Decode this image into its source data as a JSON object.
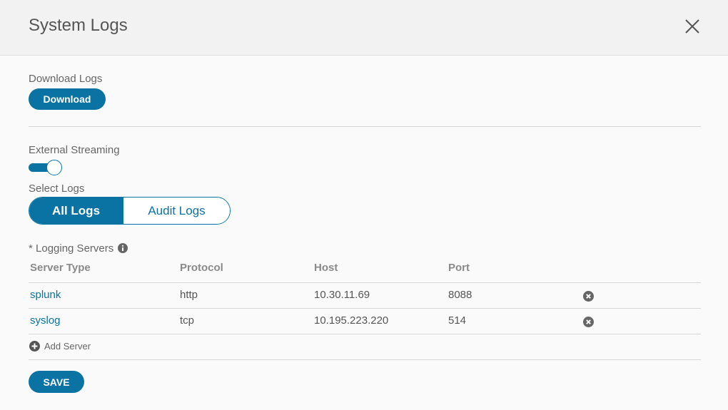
{
  "dialog": {
    "title": "System Logs"
  },
  "download": {
    "label": "Download Logs",
    "button_label": "Download"
  },
  "streaming": {
    "label": "External Streaming",
    "enabled": true
  },
  "select_logs": {
    "label": "Select Logs",
    "options": [
      "All Logs",
      "Audit Logs"
    ],
    "selected": "All Logs"
  },
  "logging_servers": {
    "label": "* Logging Servers",
    "columns": [
      "Server Type",
      "Protocol",
      "Host",
      "Port"
    ],
    "rows": [
      {
        "server_type": "splunk",
        "protocol": "http",
        "host": "10.30.11.69",
        "port": "8088"
      },
      {
        "server_type": "syslog",
        "protocol": "tcp",
        "host": "10.195.223.220",
        "port": "514"
      }
    ],
    "add_label": "Add Server"
  },
  "footer": {
    "save_label": "SAVE"
  },
  "colors": {
    "accent": "#0a73a3",
    "header_bg": "#f2f2f2",
    "icon_gray": "#666666"
  },
  "icons": {
    "close": "close-icon",
    "info": "info-icon",
    "remove": "remove-circle-icon",
    "add": "add-circle-icon"
  }
}
